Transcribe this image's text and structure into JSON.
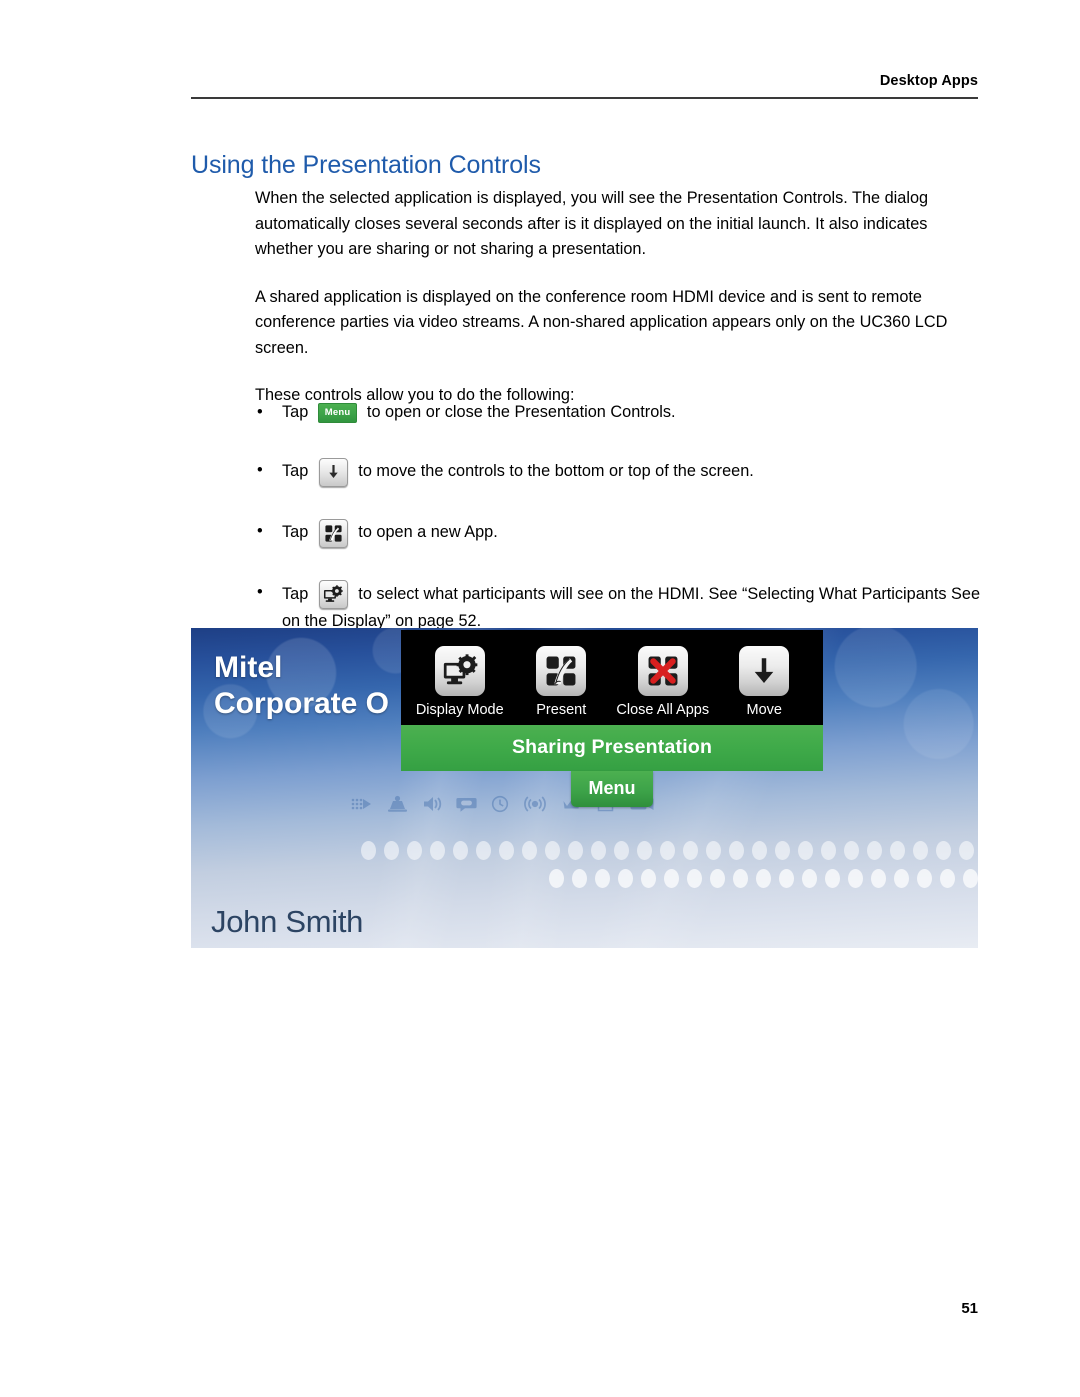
{
  "header": {
    "running_title": "Desktop Apps"
  },
  "section": {
    "title": "Using the Presentation Controls",
    "title_color": "#1f5bab"
  },
  "paragraphs": [
    "When the selected application is displayed, you will see the Presentation Controls. The dialog automatically closes several seconds after is it displayed on the initial launch. It also indicates whether you are sharing or not sharing a presentation.",
    "A shared application is displayed on the conference room HDMI device and is sent to remote conference parties via video streams. A non-shared application appears only on the UC360 LCD screen.",
    "These controls allow you to do the following:"
  ],
  "bullets": [
    {
      "marker": "•",
      "lead": "Tap ",
      "icon": "menu-chip-icon",
      "icon_label": "Menu",
      "trail": " to open or close the Presentation Controls."
    },
    {
      "marker": "•",
      "lead": "Tap ",
      "icon": "move-down-arrow-icon",
      "icon_label": "",
      "trail": " to move the controls to the bottom or top of the screen."
    },
    {
      "marker": "•",
      "lead": "Tap ",
      "icon": "present-icon",
      "icon_label": "",
      "trail": " to open a new App."
    },
    {
      "marker": "•",
      "lead": "Tap ",
      "icon": "display-mode-icon",
      "icon_label": "",
      "trail": " to select what participants will see on the HDMI. See “Selecting What Participants See on the Display” on page 52."
    }
  ],
  "screenshot": {
    "wallpaper_title": "Mitel\nCorporate O",
    "user_name": "John Smith",
    "dialog": {
      "items": [
        {
          "label": "Display Mode",
          "icon": "monitor-gear-icon"
        },
        {
          "label": "Present",
          "icon": "present-hand-panes-icon"
        },
        {
          "label": "Close All Apps",
          "icon": "red-x-close-icon"
        },
        {
          "label": "Move",
          "icon": "down-arrow-icon"
        }
      ],
      "status_label": "Sharing Presentation",
      "status_color": "#3faa49",
      "menu_tab_label": "Menu"
    },
    "status_icons": [
      "signal-dots-icon",
      "conference-icon",
      "speaker-icon",
      "voicemail-icon",
      "clock-icon",
      "wireless-icon",
      "crown-icon",
      "note-icon",
      "video-camera-icon"
    ]
  },
  "footer": {
    "page_number": "51"
  }
}
